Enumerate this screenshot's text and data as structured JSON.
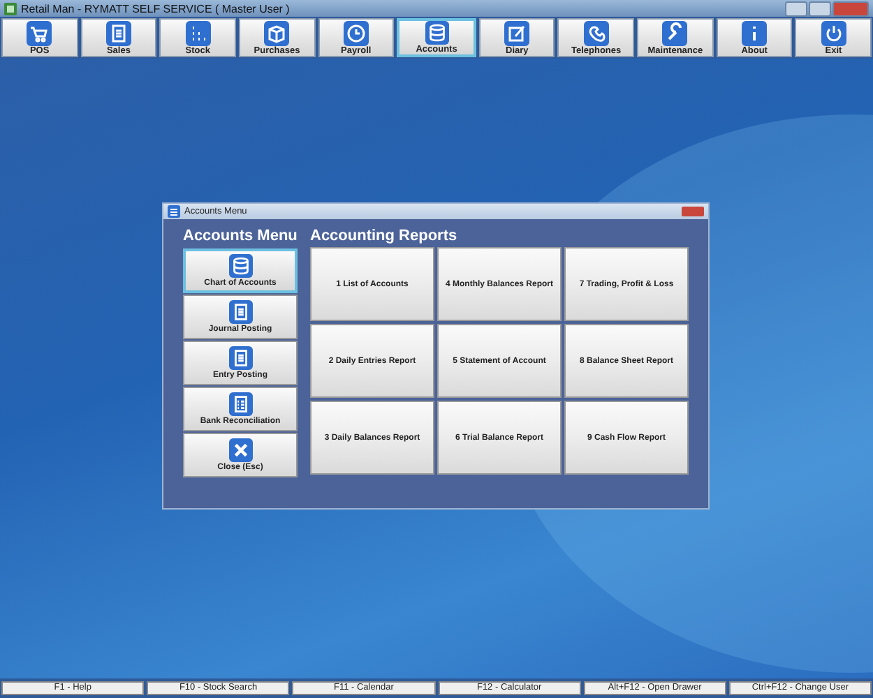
{
  "window": {
    "title": "Retail Man - RYMATT SELF SERVICE ( Master User )"
  },
  "toolbar": [
    {
      "label": "POS",
      "kind": "cart",
      "selected": false
    },
    {
      "label": "Sales",
      "kind": "doc",
      "selected": false
    },
    {
      "label": "Stock",
      "kind": "dots",
      "selected": false
    },
    {
      "label": "Purchases",
      "kind": "box",
      "selected": false
    },
    {
      "label": "Payroll",
      "kind": "clock",
      "selected": false
    },
    {
      "label": "Accounts",
      "kind": "db",
      "selected": true
    },
    {
      "label": "Diary",
      "kind": "pen",
      "selected": false
    },
    {
      "label": "Telephones",
      "kind": "phone",
      "selected": false
    },
    {
      "label": "Maintenance",
      "kind": "wrench",
      "selected": false
    },
    {
      "label": "About",
      "kind": "info",
      "selected": false
    },
    {
      "label": "Exit",
      "kind": "power",
      "selected": false
    }
  ],
  "dialog": {
    "title": "Accounts Menu",
    "menu_heading": "Accounts Menu",
    "reports_heading": "Accounting Reports",
    "menu": [
      {
        "label": "Chart of Accounts",
        "kind": "db",
        "selected": true
      },
      {
        "label": "Journal Posting",
        "kind": "doc",
        "selected": false
      },
      {
        "label": "Entry Posting",
        "kind": "doc",
        "selected": false
      },
      {
        "label": "Bank Reconciliation",
        "kind": "list",
        "selected": false
      },
      {
        "label": "Close (Esc)",
        "kind": "close",
        "selected": false
      }
    ],
    "reports": [
      "1 List of Accounts",
      "4 Monthly Balances Report",
      "7 Trading, Profit & Loss",
      "2 Daily Entries Report",
      "5 Statement of Account",
      "8 Balance Sheet Report",
      "3 Daily Balances Report",
      "6 Trial Balance Report",
      "9 Cash Flow Report"
    ]
  },
  "status_bar": [
    "F1 - Help",
    "F10 - Stock Search",
    "F11 - Calendar",
    "F12 - Calculator",
    "Alt+F12 - Open Drawer",
    "Ctrl+F12 - Change User"
  ]
}
